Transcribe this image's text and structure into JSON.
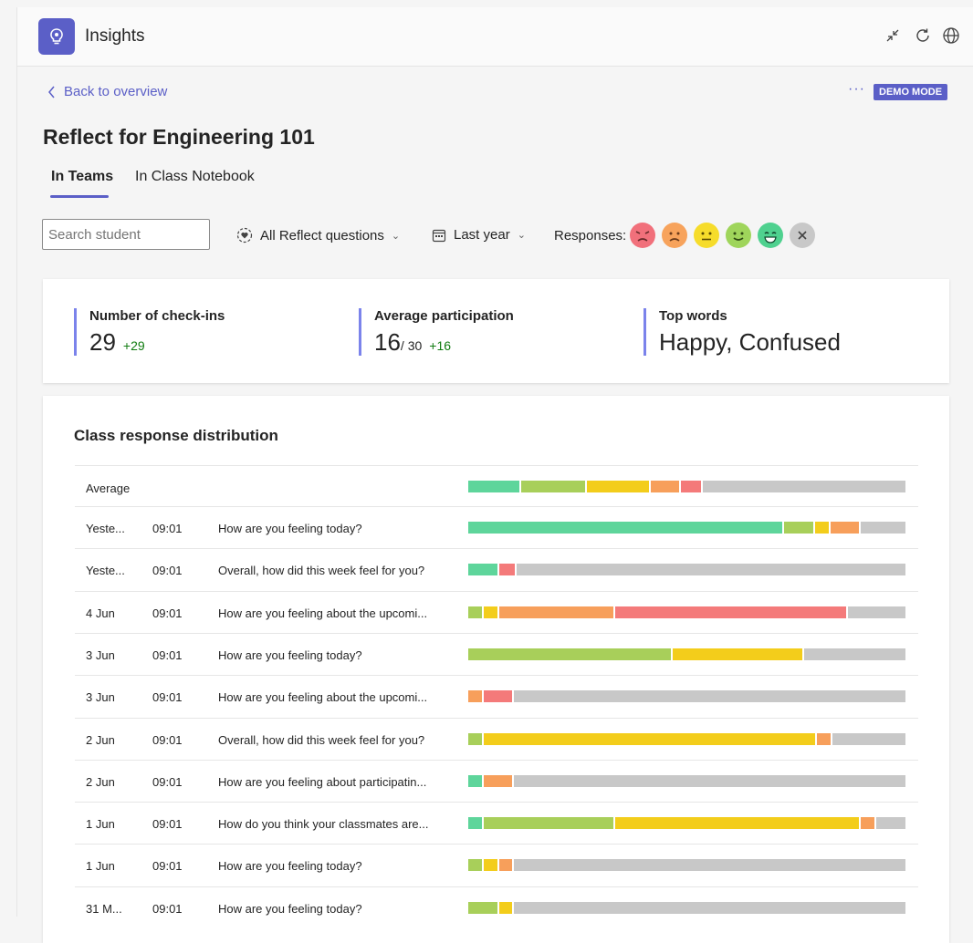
{
  "app": {
    "title": "Insights"
  },
  "nav": {
    "back_label": "Back to overview",
    "more_label": "···",
    "demo_badge": "DEMO MODE"
  },
  "page": {
    "title": "Reflect for Engineering 101"
  },
  "tabs": [
    {
      "label": "In Teams",
      "active": true
    },
    {
      "label": "In Class Notebook",
      "active": false
    }
  ],
  "filters": {
    "search_placeholder": "Search student",
    "questions_label": "All Reflect questions",
    "period_label": "Last year",
    "responses_label": "Responses:"
  },
  "response_icons": [
    {
      "icon": "miserable-face-icon",
      "color": "#f1707b"
    },
    {
      "icon": "sad-face-icon",
      "color": "#f7a35c"
    },
    {
      "icon": "neutral-face-icon",
      "color": "#f6dc2b"
    },
    {
      "icon": "smile-face-icon",
      "color": "#9fd55b"
    },
    {
      "icon": "grin-face-icon",
      "color": "#4fd18f"
    },
    {
      "icon": "clear-filter-icon",
      "color": "#c8c8c8"
    }
  ],
  "stats": {
    "checkins": {
      "label": "Number of check-ins",
      "value": "29",
      "delta": "+29"
    },
    "participation": {
      "label": "Average participation",
      "value": "16",
      "denominator": "/ 30",
      "delta": "+16"
    },
    "top_words": {
      "label": "Top words",
      "value": "Happy, Confused"
    }
  },
  "distribution": {
    "title": "Class response distribution",
    "colors": {
      "great": "#5ed59b",
      "good": "#a8cf5a",
      "ok": "#f3cd1b",
      "bad": "#f79f5b",
      "awful": "#f47a7a",
      "none": "#c8c8c8"
    },
    "average": {
      "label": "Average",
      "segments": [
        [
          "great",
          12
        ],
        [
          "good",
          15
        ],
        [
          "ok",
          14.5
        ],
        [
          "bad",
          7
        ],
        [
          "awful",
          5
        ],
        [
          "none",
          46.5
        ]
      ]
    },
    "rows": [
      {
        "date": "Yeste...",
        "time": "09:01",
        "question": "How are you feeling today?",
        "segments": [
          [
            "great",
            72
          ],
          [
            "good",
            7
          ],
          [
            "ok",
            3.5
          ],
          [
            "bad",
            7
          ],
          [
            "none",
            10.5
          ]
        ]
      },
      {
        "date": "Yeste...",
        "time": "09:01",
        "question": "Overall, how did this week feel for you?",
        "segments": [
          [
            "great",
            7
          ],
          [
            "awful",
            4
          ],
          [
            "none",
            89
          ]
        ]
      },
      {
        "date": "4 Jun",
        "time": "09:01",
        "question": "How are you feeling about the upcomi...",
        "segments": [
          [
            "good",
            3.5
          ],
          [
            "ok",
            3.5
          ],
          [
            "bad",
            26.5
          ],
          [
            "awful",
            53
          ],
          [
            "none",
            13.5
          ]
        ]
      },
      {
        "date": "3 Jun",
        "time": "09:01",
        "question": "How are you feeling today?",
        "segments": [
          [
            "good",
            46.5
          ],
          [
            "ok",
            30
          ],
          [
            "none",
            23.5
          ]
        ]
      },
      {
        "date": "3 Jun",
        "time": "09:01",
        "question": "How are you feeling about the upcomi...",
        "segments": [
          [
            "bad",
            3.5
          ],
          [
            "awful",
            7
          ],
          [
            "none",
            89.5
          ]
        ]
      },
      {
        "date": "2 Jun",
        "time": "09:01",
        "question": "Overall, how did this week feel for you?",
        "segments": [
          [
            "good",
            3.5
          ],
          [
            "ok",
            76
          ],
          [
            "bad",
            3.5
          ],
          [
            "none",
            17
          ]
        ]
      },
      {
        "date": "2 Jun",
        "time": "09:01",
        "question": "How are you feeling about participatin...",
        "segments": [
          [
            "great",
            3.5
          ],
          [
            "bad",
            7
          ],
          [
            "none",
            89.5
          ]
        ]
      },
      {
        "date": "1 Jun",
        "time": "09:01",
        "question": "How do you think your classmates are...",
        "segments": [
          [
            "great",
            3.5
          ],
          [
            "good",
            30
          ],
          [
            "ok",
            56
          ],
          [
            "bad",
            3.5
          ],
          [
            "none",
            7
          ]
        ]
      },
      {
        "date": "1 Jun",
        "time": "09:01",
        "question": "How are you feeling today?",
        "segments": [
          [
            "good",
            3.5
          ],
          [
            "ok",
            3.5
          ],
          [
            "bad",
            3.5
          ],
          [
            "none",
            89.5
          ]
        ]
      },
      {
        "date": "31 M...",
        "time": "09:01",
        "question": "How are you feeling today?",
        "segments": [
          [
            "good",
            7
          ],
          [
            "ok",
            3.5
          ],
          [
            "none",
            89.5
          ]
        ]
      }
    ]
  }
}
